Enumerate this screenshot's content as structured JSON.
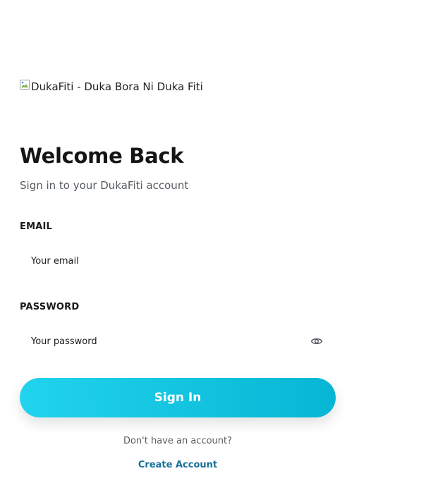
{
  "brand": {
    "logo_alt": "DukaFiti - Duka Bora Ni Duka Fiti"
  },
  "header": {
    "title": "Welcome Back",
    "subtitle": "Sign in to your DukaFiti account"
  },
  "form": {
    "email_label": "EMAIL",
    "email_placeholder": "Your email",
    "email_value": "",
    "password_label": "PASSWORD",
    "password_placeholder": "Your password",
    "password_value": "",
    "password_toggle_icon": "eye-icon",
    "submit_label": "Sign In"
  },
  "footer": {
    "no_account_text": "Don't have an account?",
    "create_account_label": "Create Account"
  },
  "colors": {
    "button_gradient_start": "#22d3ee",
    "button_gradient_end": "#06b6d4",
    "link": "#17709a",
    "muted_text": "#555b61"
  }
}
